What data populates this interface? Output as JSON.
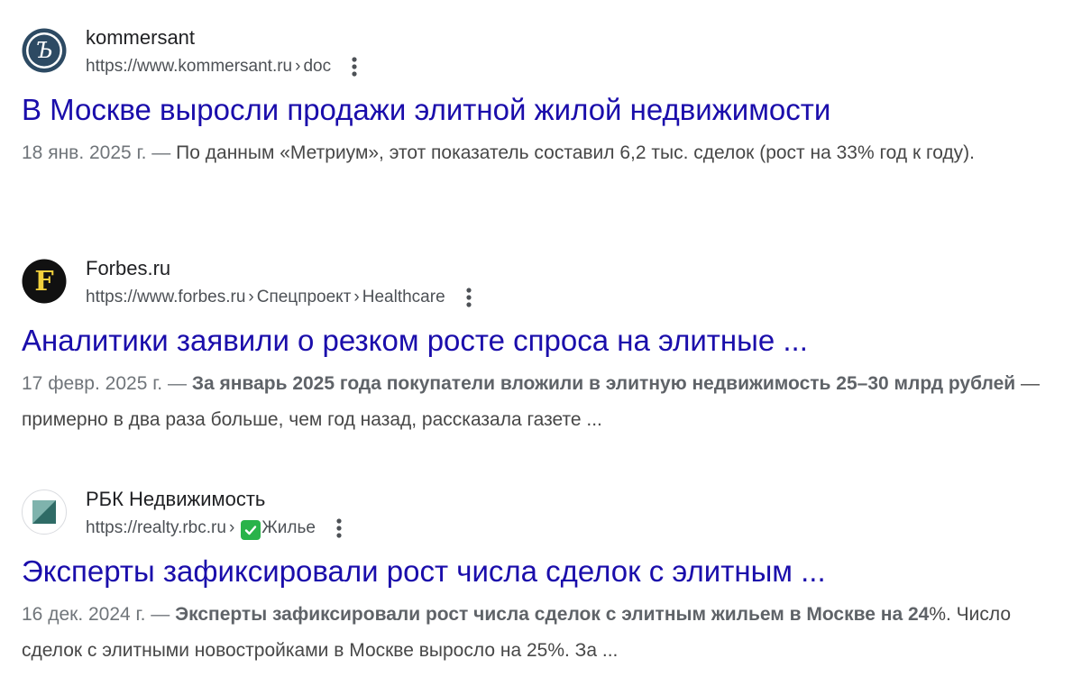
{
  "results": [
    {
      "site_name": "kommersant",
      "url": "https://www.kommersant.ru",
      "crumbs": [
        "doc"
      ],
      "title": "В Москве выросли продажи элитной жилой недвижимости",
      "date": "18 янв. 2025 г. —",
      "snippet_bold": "",
      "snippet": "По данным «Метриум», этот показатель составил 6,2 тыс. сделок (рост на 33% год к году).",
      "icon": "kommersant-logo-icon"
    },
    {
      "site_name": "Forbes.ru",
      "url": "https://www.forbes.ru",
      "crumbs": [
        "Спецпроект",
        "Healthcare"
      ],
      "title": "Аналитики заявили о резком росте спроса на элитные ...",
      "date": "17 февр. 2025 г. —",
      "snippet_bold": "За январь 2025 года покупатели вложили в элитную недвижимость 25–30 млрд рублей",
      "snippet": "— примерно в два раза больше, чем год назад, рассказала газете ...",
      "icon": "forbes-logo-icon",
      "logo_letter": "F"
    },
    {
      "site_name": "РБК Недвижимость",
      "url": "https://realty.rbc.ru",
      "crumbs": [
        "Жилье"
      ],
      "title": "Эксперты зафиксировали рост числа сделок с элитным ...",
      "date": "16 дек. 2024 г. —",
      "snippet_bold": "Эксперты зафиксировали рост числа сделок с элитным жильем в Москве на 24",
      "snippet": "%. Число сделок с элитными новостройками в Москве выросло на 25%. За ...",
      "icon": "rbc-realty-logo-icon"
    }
  ],
  "colors": {
    "title_link": "#1a0dab",
    "snippet_text": "#4d5156",
    "check_green": "#29b34a"
  },
  "icons": {
    "more": "more-vert-icon",
    "check": "check-mark-icon"
  }
}
